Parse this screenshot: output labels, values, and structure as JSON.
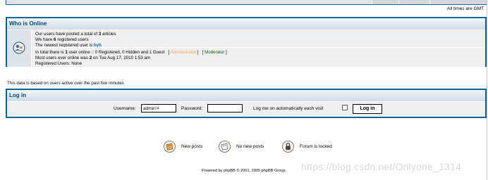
{
  "timezone_note": "All times are GMT",
  "who_is_online": {
    "title": "Who is Online",
    "stats": {
      "posted_prefix": "Our users have posted a total of ",
      "posted_count": "3",
      "posted_suffix": " articles",
      "users_prefix": "We have ",
      "users_count": "6",
      "users_suffix": " registered users",
      "newest_prefix": "The newest registered user is ",
      "newest_user": "hyh"
    },
    "online": {
      "total_prefix": "In total there is ",
      "total_count": "1",
      "total_suffix": " user online :: 0 Registered, 0 Hidden and 1 Guest",
      "admin_label": "Administrator",
      "mod_label": "Moderator",
      "most_prefix": "Most users ever online was ",
      "most_count": "2",
      "most_suffix": " on Tue Aug 17, 2010 1:53 am",
      "registered_users": "Registered Users: None"
    },
    "colors": {
      "admin": "#ffa34f",
      "mod": "#006600"
    }
  },
  "data_note": "This data is based on users active over the past five minutes",
  "login": {
    "title": "Log in",
    "username_label": "Username:",
    "username_value": "admin'#",
    "password_label": "Password:",
    "password_value": "",
    "autologin_label": "Log me on automatically each visit",
    "button_label": "Log in"
  },
  "legend": [
    {
      "label": "New posts",
      "icon": "folder-new-icon"
    },
    {
      "label": "No new posts",
      "icon": "folder-icon"
    },
    {
      "label": "Forum is locked",
      "icon": "folder-locked-icon"
    }
  ],
  "footer": {
    "powered_by": "Powered by phpBB © 2001, 2005 phpBB Group",
    "watermark": "https://blog.csdn.net/Onlyone_1314"
  },
  "theme": {
    "border": "#006699",
    "header_text": "#004c75",
    "row_bg": "#efefef"
  }
}
